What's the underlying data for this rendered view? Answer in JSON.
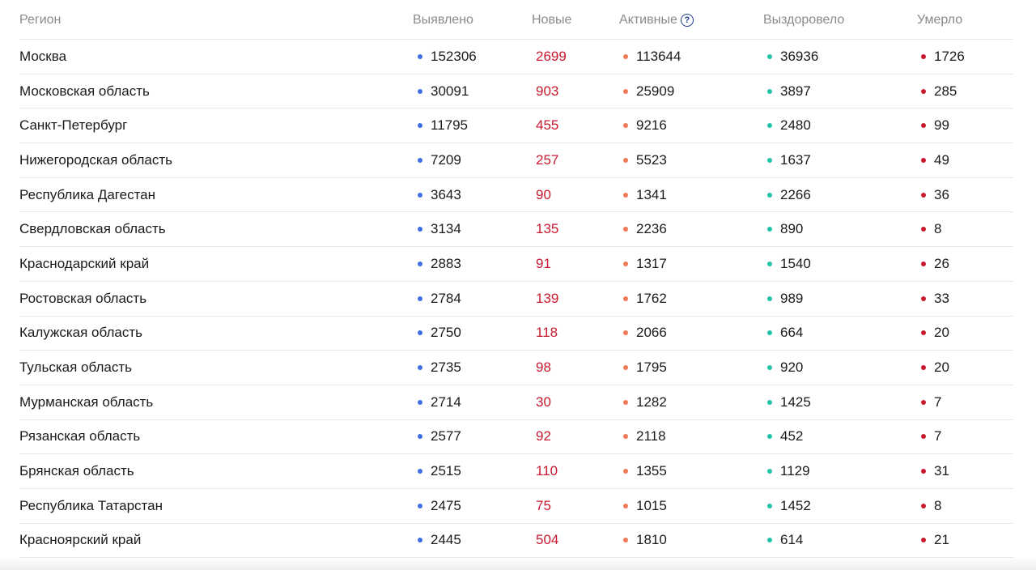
{
  "header": {
    "region": "Регион",
    "detected": "Выявлено",
    "new": "Новые",
    "active": "Активные",
    "active_help_icon": "question-circle-icon",
    "recovered": "Выздоровело",
    "died": "Умерло"
  },
  "colors": {
    "detected_dot": "#3d6fe3",
    "new_text": "#c8192f",
    "active_dot": "#f07a56",
    "recovered_dot": "#21c4a5",
    "died_dot": "#c8192f"
  },
  "rows": [
    {
      "region": "Москва",
      "detected": "152306",
      "new": "2699",
      "active": "113644",
      "recovered": "36936",
      "died": "1726"
    },
    {
      "region": "Московская область",
      "detected": "30091",
      "new": "903",
      "active": "25909",
      "recovered": "3897",
      "died": "285"
    },
    {
      "region": "Санкт-Петербург",
      "detected": "11795",
      "new": "455",
      "active": "9216",
      "recovered": "2480",
      "died": "99"
    },
    {
      "region": "Нижегородская область",
      "detected": "7209",
      "new": "257",
      "active": "5523",
      "recovered": "1637",
      "died": "49"
    },
    {
      "region": "Республика Дагестан",
      "detected": "3643",
      "new": "90",
      "active": "1341",
      "recovered": "2266",
      "died": "36"
    },
    {
      "region": "Свердловская область",
      "detected": "3134",
      "new": "135",
      "active": "2236",
      "recovered": "890",
      "died": "8"
    },
    {
      "region": "Краснодарский край",
      "detected": "2883",
      "new": "91",
      "active": "1317",
      "recovered": "1540",
      "died": "26"
    },
    {
      "region": "Ростовская область",
      "detected": "2784",
      "new": "139",
      "active": "1762",
      "recovered": "989",
      "died": "33"
    },
    {
      "region": "Калужская область",
      "detected": "2750",
      "new": "118",
      "active": "2066",
      "recovered": "664",
      "died": "20"
    },
    {
      "region": "Тульская область",
      "detected": "2735",
      "new": "98",
      "active": "1795",
      "recovered": "920",
      "died": "20"
    },
    {
      "region": "Мурманская область",
      "detected": "2714",
      "new": "30",
      "active": "1282",
      "recovered": "1425",
      "died": "7"
    },
    {
      "region": "Рязанская область",
      "detected": "2577",
      "new": "92",
      "active": "2118",
      "recovered": "452",
      "died": "7"
    },
    {
      "region": "Брянская область",
      "detected": "2515",
      "new": "110",
      "active": "1355",
      "recovered": "1129",
      "died": "31"
    },
    {
      "region": "Республика Татарстан",
      "detected": "2475",
      "new": "75",
      "active": "1015",
      "recovered": "1452",
      "died": "8"
    },
    {
      "region": "Красноярский край",
      "detected": "2445",
      "new": "504",
      "active": "1810",
      "recovered": "614",
      "died": "21"
    }
  ]
}
